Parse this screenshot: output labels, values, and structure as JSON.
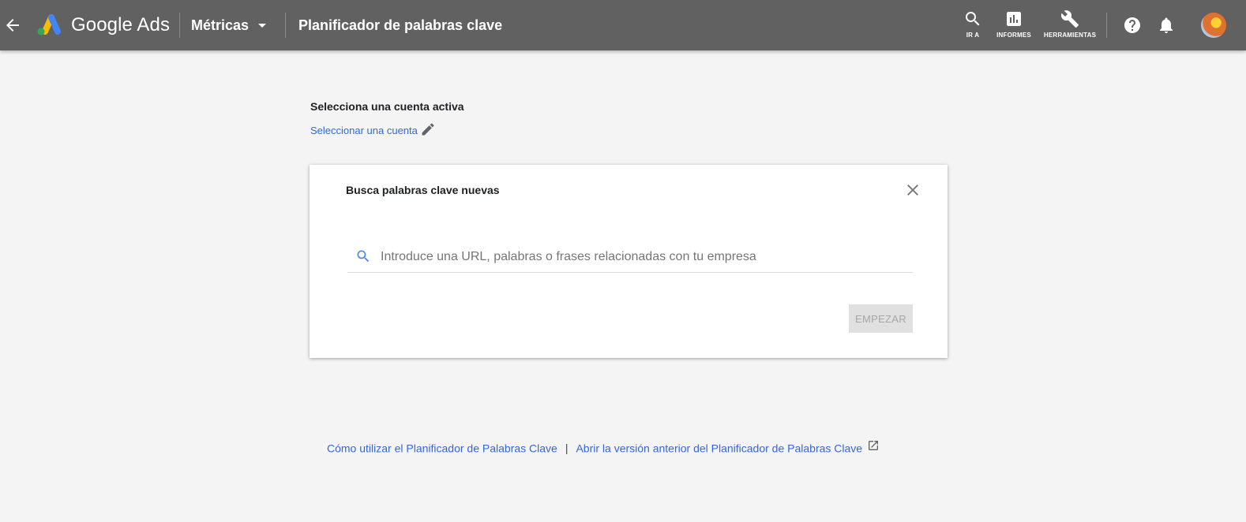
{
  "header": {
    "brand": "Google Ads",
    "account": "Métricas",
    "page_title": "Planificador de palabras clave",
    "tools": [
      {
        "label": "IR A",
        "icon": "search-icon"
      },
      {
        "label": "INFORMES",
        "icon": "bar-chart-icon"
      },
      {
        "label": "HERRAMIENTAS",
        "icon": "wrench-icon"
      }
    ],
    "icons": [
      "back-arrow-icon",
      "google-ads-logo",
      "chevron-down-icon",
      "help-icon",
      "bell-icon",
      "avatar"
    ]
  },
  "account_section": {
    "title": "Selecciona una cuenta activa",
    "link": "Seleccionar una cuenta",
    "icon": "pencil-icon"
  },
  "card": {
    "title": "Busca palabras clave nuevas",
    "search_placeholder": "Introduce una URL, palabras o frases relacionadas con tu empresa",
    "search_value": "",
    "start_button": "EMPEZAR",
    "close_icon": "close-icon"
  },
  "footer": {
    "link1": "Cómo utilizar el Planificador de Palabras Clave",
    "separator": "|",
    "link2": "Abrir la versión anterior del Planificador de Palabras Clave",
    "icon": "external-link-icon"
  },
  "colors": {
    "topbar": "#616161",
    "background": "#f4f4f4",
    "link": "#3367d6",
    "logo_blue": "#4285f4",
    "logo_yellow": "#fbbc04",
    "logo_green": "#34a853"
  }
}
